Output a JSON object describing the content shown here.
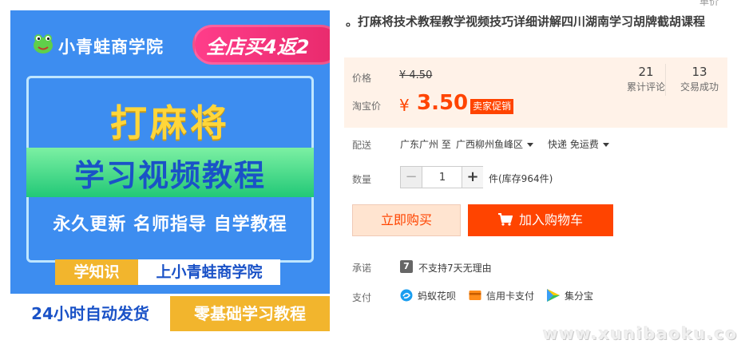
{
  "image": {
    "brand": "小青蛙商学院",
    "promo_badge": "全店买4返2",
    "headline_1": "打麻将",
    "headline_2": "学习视频教程",
    "slogan": "永久更新 名师指导 自学教程",
    "tag_left": "学知识",
    "tag_right": "上小青蛙商学院",
    "bottom_left": "24小时自动发货",
    "bottom_right": "零基础学习教程"
  },
  "top_corner": "单价",
  "product": {
    "title": "。打麻将技术教程教学视频技巧详细讲解四川湖南学习胡牌截胡课程"
  },
  "price": {
    "label_original": "价格",
    "original_value": "¥ 4.50",
    "label_taobao": "淘宝价",
    "currency_symbol": "¥",
    "current_value": "3.50",
    "promo_tag": "卖家促销"
  },
  "stats": {
    "reviews_count": "21",
    "reviews_label": "累计评论",
    "sales_count": "13",
    "sales_label": "交易成功"
  },
  "shipping": {
    "label": "配送",
    "from": "广东广州 至",
    "to": "广西柳州鱼峰区",
    "method": "快递 免运费"
  },
  "quantity": {
    "label": "数量",
    "minus": "−",
    "value": "1",
    "plus": "+",
    "stock": "件(库存964件)"
  },
  "actions": {
    "buy_now": "立即购买",
    "add_to_cart": "加入购物车"
  },
  "promise": {
    "label": "承诺",
    "icon_glyph": "7",
    "text": "不支持7天无理由"
  },
  "payment": {
    "label": "支付",
    "methods": [
      "蚂蚁花呗",
      "信用卡支付",
      "集分宝"
    ]
  },
  "watermark": "www.xunibaoku.com",
  "colors": {
    "accent": "#ff4400",
    "price_bg": "#fff2e8",
    "image_blue": "#3d8df0",
    "image_yellow": "#f2b52d"
  }
}
